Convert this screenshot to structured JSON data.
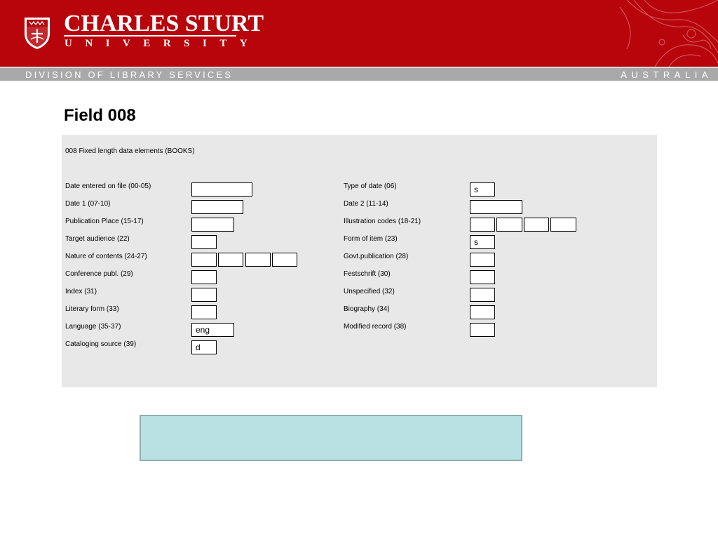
{
  "header": {
    "title": "CHARLES STURT",
    "subtitle": "UNIVERSITY",
    "division": "DIVISION OF LIBRARY SERVICES",
    "country": "AUSTRALIA",
    "brand_color": "#b8040b",
    "logo_icon": "university-crest-icon"
  },
  "page_title": "Field 008",
  "form": {
    "heading": "008 Fixed length data elements (BOOKS)",
    "left": [
      {
        "label": "Date entered on file (00-05)",
        "values": [
          ""
        ]
      },
      {
        "label": "Date 1 (07-10)",
        "values": [
          ""
        ]
      },
      {
        "label": "Publication Place (15-17)",
        "values": [
          ""
        ]
      },
      {
        "label": "Target audience (22)",
        "values": [
          ""
        ]
      },
      {
        "label": "Nature of contents (24-27)",
        "values": [
          "",
          "",
          "",
          ""
        ]
      },
      {
        "label": "Conference publ. (29)",
        "values": [
          ""
        ]
      },
      {
        "label": "Index (31)",
        "values": [
          ""
        ]
      },
      {
        "label": "Literary form (33)",
        "values": [
          ""
        ]
      },
      {
        "label": "Language (35-37)",
        "values": [
          "eng"
        ]
      },
      {
        "label": "Cataloging source (39)",
        "values": [
          "d"
        ]
      }
    ],
    "right": [
      {
        "label": "Type of date (06)",
        "values": [
          "s"
        ]
      },
      {
        "label": "Date 2 (11-14)",
        "values": [
          ""
        ]
      },
      {
        "label": "Illustration codes (18-21)",
        "values": [
          "",
          "",
          "",
          ""
        ]
      },
      {
        "label": "Form of item (23)",
        "values": [
          "s"
        ]
      },
      {
        "label": "Govt.publication (28)",
        "values": [
          ""
        ]
      },
      {
        "label": "Festschrift (30)",
        "values": [
          ""
        ]
      },
      {
        "label": "Unspecified (32)",
        "values": [
          ""
        ]
      },
      {
        "label": "Biography (34)",
        "values": [
          ""
        ]
      },
      {
        "label": "Modified record (38)",
        "values": [
          ""
        ]
      }
    ]
  }
}
